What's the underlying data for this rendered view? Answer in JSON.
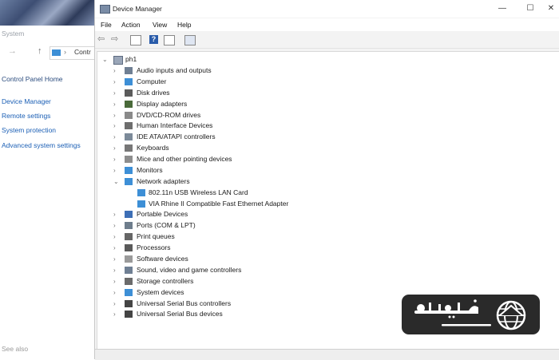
{
  "background_window": {
    "title": "System",
    "address_text": "Contr",
    "home_link": "Control Panel Home",
    "links": [
      "Device Manager",
      "Remote settings",
      "System protection",
      "Advanced system settings"
    ],
    "see_also": "See also"
  },
  "window": {
    "title": "Device Manager",
    "minimize_label": "—",
    "maximize_label": "☐",
    "close_label": "✕"
  },
  "menu": [
    "File",
    "Action",
    "View",
    "Help"
  ],
  "toolbar": {
    "help_label": "?"
  },
  "tree": {
    "root": "ph1",
    "categories": [
      {
        "label": "Audio inputs and outputs",
        "icon": "speaker-icon",
        "expanded": false
      },
      {
        "label": "Computer",
        "icon": "monitor-icon",
        "expanded": false
      },
      {
        "label": "Disk drives",
        "icon": "disk-icon",
        "expanded": false
      },
      {
        "label": "Display adapters",
        "icon": "display-adapter-icon",
        "expanded": false
      },
      {
        "label": "DVD/CD-ROM drives",
        "icon": "dvd-icon",
        "expanded": false
      },
      {
        "label": "Human Interface Devices",
        "icon": "hid-icon",
        "expanded": false
      },
      {
        "label": "IDE ATA/ATAPI controllers",
        "icon": "ide-controller-icon",
        "expanded": false
      },
      {
        "label": "Keyboards",
        "icon": "keyboard-icon",
        "expanded": false
      },
      {
        "label": "Mice and other pointing devices",
        "icon": "mouse-icon",
        "expanded": false
      },
      {
        "label": "Monitors",
        "icon": "monitor-icon",
        "expanded": false
      },
      {
        "label": "Network adapters",
        "icon": "network-icon",
        "expanded": true,
        "children": [
          "802.11n USB Wireless LAN Card",
          "VIA Rhine II Compatible Fast Ethernet Adapter"
        ]
      },
      {
        "label": "Portable Devices",
        "icon": "portable-device-icon",
        "expanded": false
      },
      {
        "label": "Ports (COM & LPT)",
        "icon": "port-icon",
        "expanded": false
      },
      {
        "label": "Print queues",
        "icon": "printer-icon",
        "expanded": false
      },
      {
        "label": "Processors",
        "icon": "processor-icon",
        "expanded": false
      },
      {
        "label": "Software devices",
        "icon": "software-device-icon",
        "expanded": false
      },
      {
        "label": "Sound, video and game controllers",
        "icon": "speaker-icon",
        "expanded": false
      },
      {
        "label": "Storage controllers",
        "icon": "storage-controller-icon",
        "expanded": false
      },
      {
        "label": "System devices",
        "icon": "system-device-icon",
        "expanded": false
      },
      {
        "label": "Universal Serial Bus controllers",
        "icon": "usb-icon",
        "expanded": false
      },
      {
        "label": "Universal Serial Bus devices",
        "icon": "usb-icon",
        "expanded": false
      }
    ]
  },
  "watermark": {
    "colors": {
      "background": "#2a2a2a",
      "foreground": "#ffffff"
    }
  },
  "colors": {
    "link": "#1b5fb5",
    "window_bg": "#f3f3f3",
    "device_icon": "#3d8fd6"
  }
}
